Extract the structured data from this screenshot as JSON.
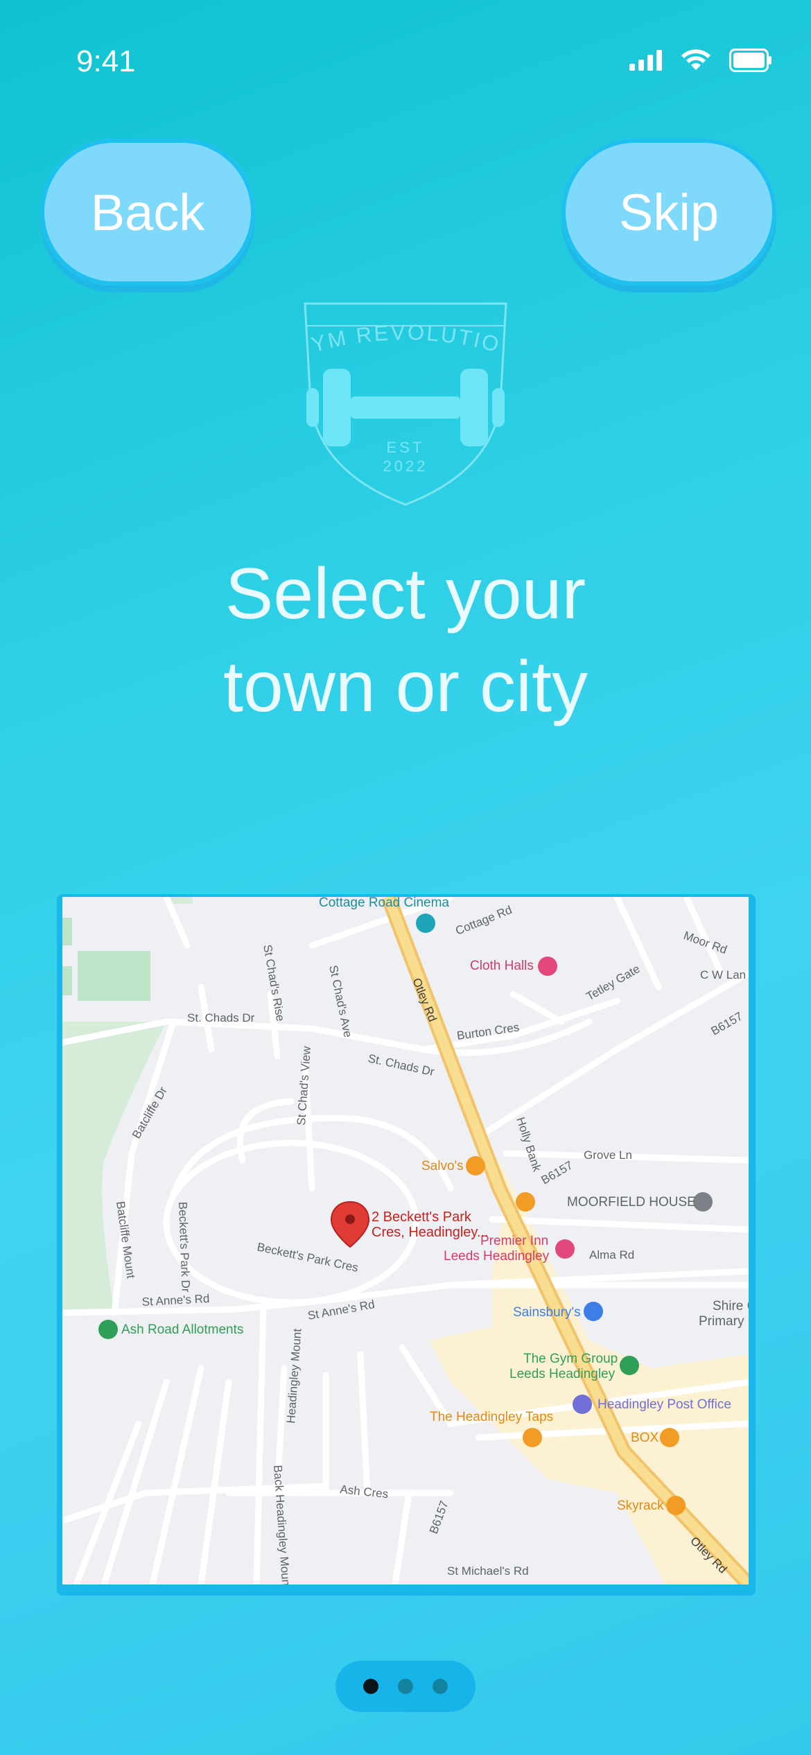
{
  "status": {
    "time": "9:41"
  },
  "header": {
    "back_label": "Back",
    "skip_label": "Skip"
  },
  "logo": {
    "brand": "GYM REVOLUTION",
    "est": "EST",
    "year": "2022"
  },
  "headline": {
    "line1": "Select your",
    "line2": "town or city"
  },
  "map": {
    "selected_place_line1": "2 Beckett's Park",
    "selected_place_line2": "Cres, Headingley...",
    "pois": {
      "cottage_road_cinema": "Cottage Road Cinema",
      "cloth_halls": "Cloth Halls",
      "salvos": "Salvo's",
      "moorfield_house": "MOORFIELD HOUSE",
      "premier_inn_1": "Premier Inn",
      "premier_inn_2": "Leeds Headingley",
      "sainsburys": "Sainsbury's",
      "ash_road_allotments": "Ash Road Allotments",
      "gym_group_1": "The Gym Group",
      "gym_group_2": "Leeds Headingley",
      "post_office": "Headingley Post Office",
      "headingley_taps": "The Headingley Taps",
      "box": "BOX",
      "skyrack": "Skyrack",
      "shire_1": "Shire C",
      "shire_2": "Primary"
    },
    "roads": {
      "cottage_rd": "Cottage Rd",
      "otley_rd": "Otley Rd",
      "otley_rd_2": "Otley Rd",
      "st_chads_dr": "St. Chads Dr",
      "st_chads_dr_2": "St. Chads Dr",
      "st_chads_rise": "St Chad's Rise",
      "st_chads_ave": "St Chad's Ave",
      "st_chads_view": "St Chad's View",
      "burton_cres": "Burton Cres",
      "tetley_gate": "Tetley Gate",
      "moor_rd": "Moor Rd",
      "cw_lane": "C W Lan",
      "b6157_1": "B6157",
      "b6157_2": "B6157",
      "b6157_3": "B6157",
      "holly_bank": "Holly Bank",
      "grove_ln": "Grove Ln",
      "batcliffe_dr": "Batcliffe Dr",
      "batcliffe_mount": "Batcliffe Mount",
      "becketts_park_dr": "Beckett's Park Dr",
      "becketts_park_cres": "Beckett's Park Cres",
      "alma_rd": "Alma Rd",
      "st_annes_rd": "St Anne's Rd",
      "st_annes_rd_2": "St Anne's Rd",
      "headingley_mount": "Headingley Mount",
      "back_headingley_mount": "Back Headingley Mount",
      "ash_cres": "Ash Cres",
      "st_michaels_rd": "St Michael's Rd"
    }
  },
  "pager": {
    "total": 3,
    "active_index": 0
  },
  "colors": {
    "accent": "#7fd9fb",
    "button_border": "#1ec0ee",
    "pin": "#e03b34",
    "major_road": "#f7d27a"
  }
}
